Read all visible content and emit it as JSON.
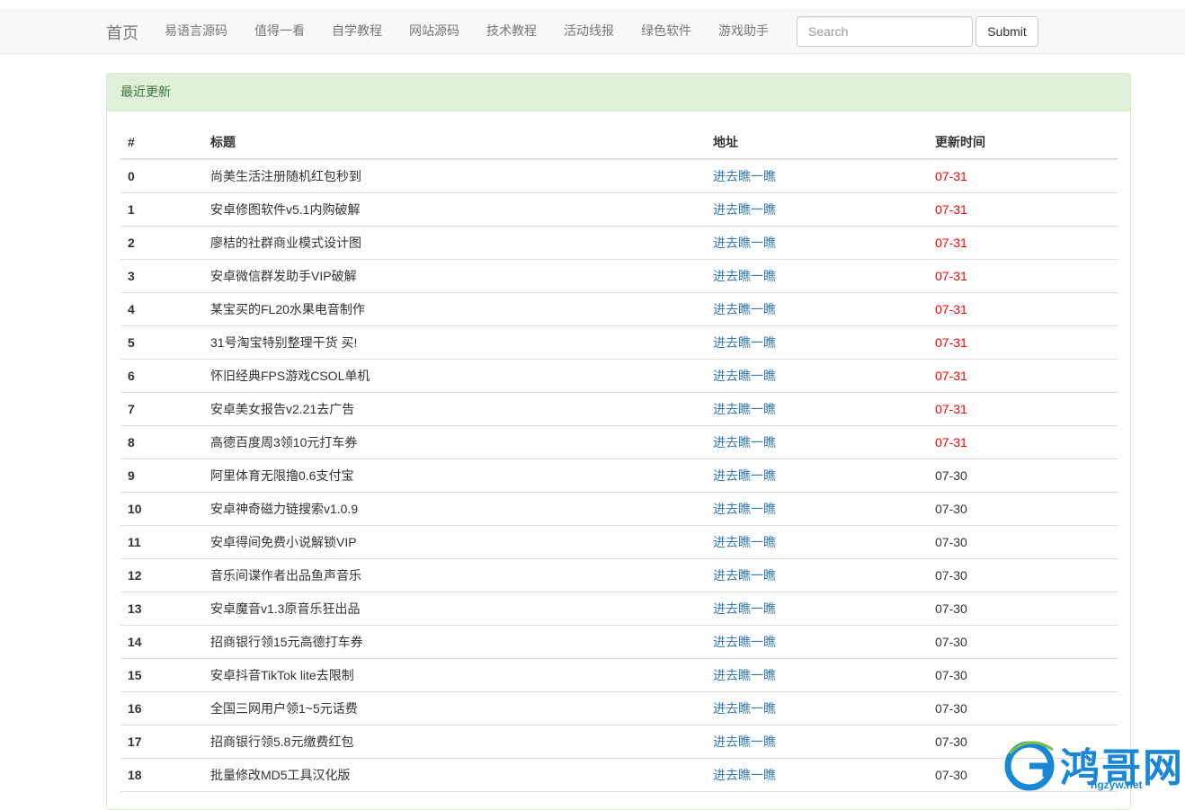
{
  "nav": {
    "brand": "首页",
    "items": [
      "易语言源码",
      "值得一看",
      "自学教程",
      "网站源码",
      "技术教程",
      "活动线报",
      "绿色软件",
      "游戏助手"
    ],
    "search_placeholder": "Search",
    "submit_label": "Submit"
  },
  "panel": {
    "heading": "最近更新"
  },
  "table": {
    "headers": [
      "#",
      "标题",
      "地址",
      "更新时间"
    ],
    "rows": [
      {
        "num": "0",
        "title": "尚美生活注册随机红包秒到",
        "link": "进去瞧一瞧",
        "date": "07-31"
      },
      {
        "num": "1",
        "title": "安卓修图软件v5.1内购破解",
        "link": "进去瞧一瞧",
        "date": "07-31"
      },
      {
        "num": "2",
        "title": "廖桔的社群商业模式设计图",
        "link": "进去瞧一瞧",
        "date": "07-31"
      },
      {
        "num": "3",
        "title": "安卓微信群发助手VIP破解",
        "link": "进去瞧一瞧",
        "date": "07-31"
      },
      {
        "num": "4",
        "title": "某宝买的FL20水果电音制作",
        "link": "进去瞧一瞧",
        "date": "07-31"
      },
      {
        "num": "5",
        "title": "31号淘宝特别整理干货 买!",
        "link": "进去瞧一瞧",
        "date": "07-31"
      },
      {
        "num": "6",
        "title": "怀旧经典FPS游戏CSOL单机",
        "link": "进去瞧一瞧",
        "date": "07-31"
      },
      {
        "num": "7",
        "title": "安卓美女报告v2.21去广告",
        "link": "进去瞧一瞧",
        "date": "07-31"
      },
      {
        "num": "8",
        "title": "高德百度周3领10元打车券",
        "link": "进去瞧一瞧",
        "date": "07-31"
      },
      {
        "num": "9",
        "title": "阿里体育无限撸0.6支付宝",
        "link": "进去瞧一瞧",
        "date": "07-30"
      },
      {
        "num": "10",
        "title": "安卓神奇磁力链搜索v1.0.9",
        "link": "进去瞧一瞧",
        "date": "07-30"
      },
      {
        "num": "11",
        "title": "安卓得间免费小说解锁VIP",
        "link": "进去瞧一瞧",
        "date": "07-30"
      },
      {
        "num": "12",
        "title": "音乐间谍作者出品鱼声音乐",
        "link": "进去瞧一瞧",
        "date": "07-30"
      },
      {
        "num": "13",
        "title": "安卓魔音v1.3原音乐狂出品",
        "link": "进去瞧一瞧",
        "date": "07-30"
      },
      {
        "num": "14",
        "title": "招商银行领15元高德打车券",
        "link": "进去瞧一瞧",
        "date": "07-30"
      },
      {
        "num": "15",
        "title": "安卓抖音TikTok lite去限制",
        "link": "进去瞧一瞧",
        "date": "07-30"
      },
      {
        "num": "16",
        "title": "全国三网用户领1~5元话费",
        "link": "进去瞧一瞧",
        "date": "07-30"
      },
      {
        "num": "17",
        "title": "招商银行领5.8元缴费红包",
        "link": "进去瞧一瞧",
        "date": "07-30"
      },
      {
        "num": "18",
        "title": "批量修改MD5工具汉化版",
        "link": "进去瞧一瞧",
        "date": "07-30"
      }
    ],
    "recent_date": "07-31"
  },
  "watermark": {
    "text": "鸿哥网",
    "url": "hgzyw.net"
  },
  "colors": {
    "link": "#337ab7",
    "recent_date": "#ff0000",
    "panel_heading_bg": "#dff0d8",
    "panel_heading_text": "#3c763d",
    "watermark": "#1a87d6"
  }
}
